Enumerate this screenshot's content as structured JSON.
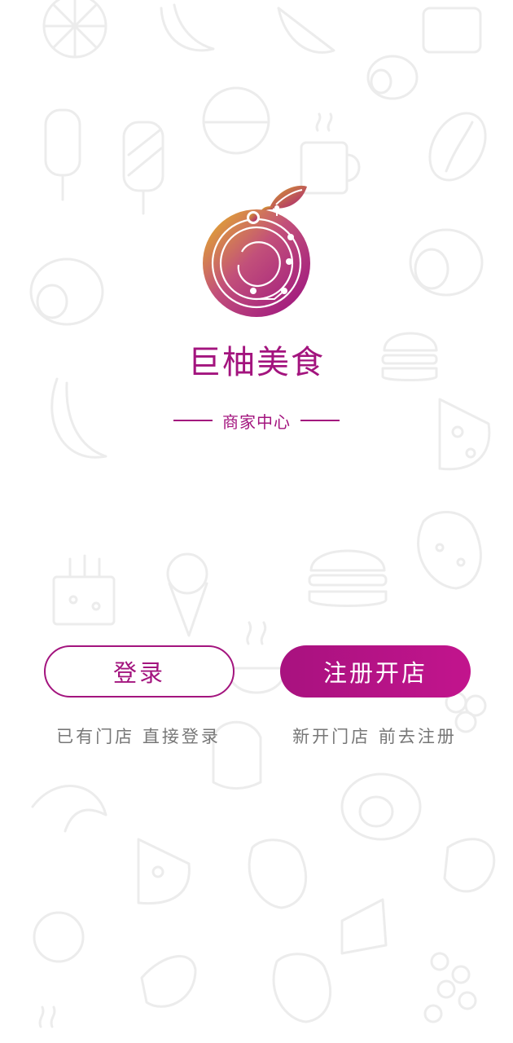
{
  "brand": {
    "name": "巨柚美食",
    "subtitle": "商家中心",
    "accent_color": "#a3147e",
    "logo_icon": "grapefruit-circuit-logo"
  },
  "actions": {
    "login_label": "登录",
    "register_label": "注册开店",
    "login_hint": "已有门店 直接登录",
    "register_hint": "新开门店 前去注册"
  },
  "background": {
    "pattern": "food-doodles",
    "color": "#f1f1f1"
  }
}
